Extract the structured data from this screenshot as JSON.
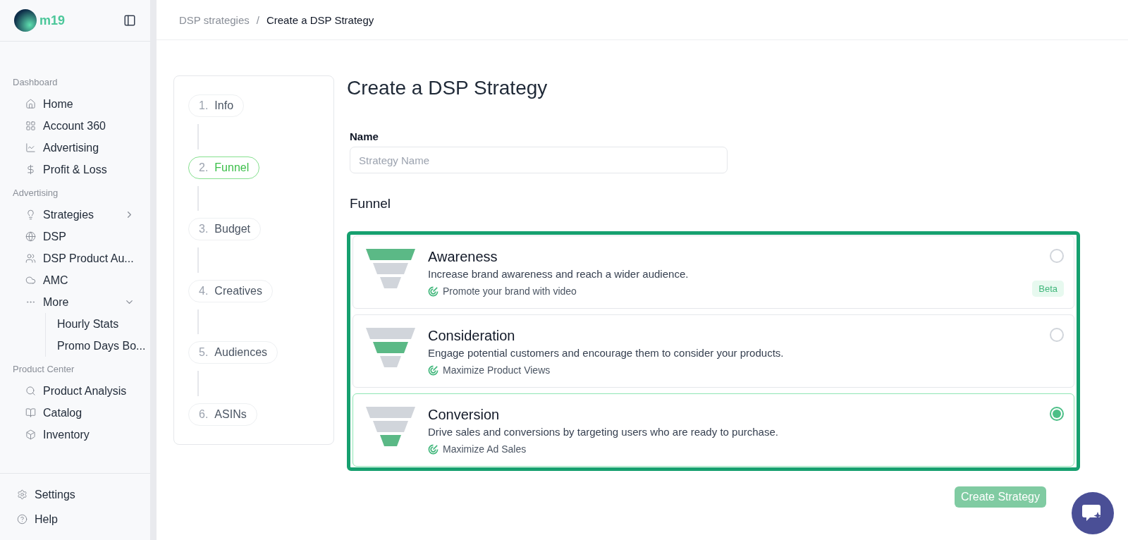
{
  "sidebar": {
    "brand": "m19",
    "sections": [
      {
        "title": "Dashboard",
        "items": [
          {
            "label": "Home"
          },
          {
            "label": "Account 360"
          },
          {
            "label": "Advertising"
          },
          {
            "label": "Profit & Loss"
          }
        ]
      },
      {
        "title": "Advertising",
        "items": [
          {
            "label": "Strategies",
            "expanded": false
          },
          {
            "label": "DSP"
          },
          {
            "label": "DSP Product Au..."
          },
          {
            "label": "AMC"
          },
          {
            "label": "More",
            "expanded": true,
            "children": [
              {
                "label": "Hourly Stats"
              },
              {
                "label": "Promo Days Bo..."
              }
            ]
          }
        ]
      },
      {
        "title": "Product Center",
        "items": [
          {
            "label": "Product Analysis"
          },
          {
            "label": "Catalog"
          },
          {
            "label": "Inventory"
          }
        ]
      }
    ],
    "footer": [
      {
        "label": "Settings"
      },
      {
        "label": "Help"
      }
    ]
  },
  "breadcrumb": [
    {
      "label": "DSP strategies"
    },
    {
      "label": "Create a DSP Strategy"
    }
  ],
  "breadcrumb_separator": "/",
  "steps": [
    {
      "number": "1.",
      "label": "Info",
      "selected": false
    },
    {
      "number": "2.",
      "label": "Funnel",
      "selected": true
    },
    {
      "number": "3.",
      "label": "Budget",
      "selected": false
    },
    {
      "number": "4.",
      "label": "Creatives",
      "selected": false
    },
    {
      "number": "5.",
      "label": "Audiences",
      "selected": false
    },
    {
      "number": "6.",
      "label": "ASINs",
      "selected": false
    }
  ],
  "form": {
    "title": "Create a DSP Strategy",
    "name_label": "Name",
    "name_placeholder": "Strategy Name",
    "funnel_label": "Funnel",
    "options": [
      {
        "kind": "top",
        "title": "Awareness",
        "description": "Increase brand awareness and reach a wider audience.",
        "goal": "Promote your brand with video",
        "badge": "Beta",
        "selected": false
      },
      {
        "kind": "middle",
        "title": "Consideration",
        "description": "Engage potential customers and encourage them to consider your products.",
        "goal": "Maximize Product Views",
        "selected": false
      },
      {
        "kind": "bottom",
        "title": "Conversion",
        "description": "Drive sales and conversions by targeting users who are ready to purchase.",
        "goal": "Maximize Ad Sales",
        "selected": true
      }
    ],
    "submit": {
      "label": "Create Strategy",
      "disabled": true
    }
  }
}
